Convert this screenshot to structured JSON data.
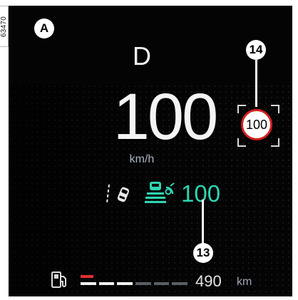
{
  "figure": {
    "reference_number": "63470",
    "callout_a": "A",
    "callout_14": "14",
    "callout_13": "13"
  },
  "cluster": {
    "gear": "D",
    "speed": "100",
    "speed_unit": "km/h",
    "speed_limit_sign": "100",
    "cruise_set_speed": "100",
    "range_value": "490",
    "range_unit": "km",
    "fuel_level_fraction": 0.5
  },
  "icons": {
    "lane": "lane-assist-icon",
    "acc": "adaptive-cruise-icon",
    "fuel": "fuel-pump-icon"
  },
  "colors": {
    "background": "#040404",
    "accent": "#2fd5b2",
    "limit_ring": "#d42020",
    "fuel_warning": "#e03030"
  }
}
